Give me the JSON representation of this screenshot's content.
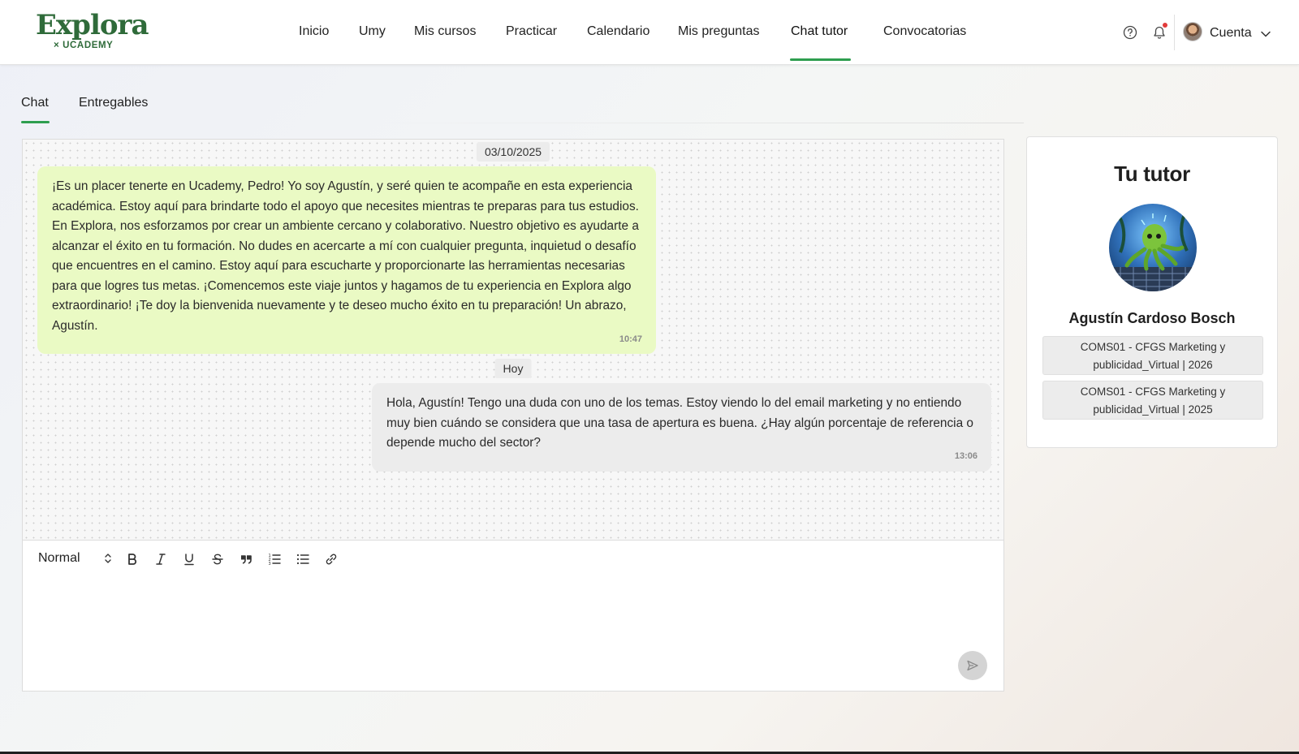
{
  "brand": {
    "name": "Explora",
    "sub": "× UCADEMY",
    "color": "#2f6b3a"
  },
  "nav": {
    "items": [
      {
        "label": "Inicio"
      },
      {
        "label": "Umy"
      },
      {
        "label": "Mis cursos"
      },
      {
        "label": "Practicar"
      },
      {
        "label": "Calendario"
      },
      {
        "label": "Mis preguntas"
      },
      {
        "label": "Chat tutor",
        "active": true
      },
      {
        "label": "Convocatorias"
      }
    ],
    "accent": "#2e9e4f"
  },
  "header": {
    "help_icon": "help-circle-icon",
    "bell_icon": "bell-icon",
    "account_label": "Cuenta"
  },
  "tabs": [
    {
      "label": "Chat",
      "active": true
    },
    {
      "label": "Entregables"
    }
  ],
  "chat": {
    "date_1": "03/10/2025",
    "message_in": {
      "text": "¡Es un placer tenerte en Ucademy, Pedro! Yo soy Agustín, y seré quien te acompañe en esta experiencia académica. Estoy aquí para brindarte todo el apoyo que necesites mientras te preparas para tus estudios. En Explora, nos esforzamos por crear un ambiente cercano y colaborativo. Nuestro objetivo es ayudarte a alcanzar el éxito en tu formación. No dudes en acercarte a mí con cualquier pregunta, inquietud o desafío que encuentres en el camino. Estoy aquí para escucharte y proporcionarte las herramientas necesarias para que logres tus metas. ¡Comencemos este viaje juntos y hagamos de tu experiencia en Explora algo extraordinario! ¡Te doy la bienvenida nuevamente y te deseo mucho éxito en tu preparación! Un abrazo, Agustín.",
      "time": "10:47",
      "bg": "#eafac4"
    },
    "date_2": "Hoy",
    "message_out": {
      "text": "Hola, Agustín! Tengo una duda con uno de los temas. Estoy viendo lo del email marketing y no entiendo muy bien cuándo se considera que una tasa de apertura es buena. ¿Hay algún porcentaje de referencia o depende mucho del sector?",
      "time": "13:06",
      "bg": "#ececec"
    }
  },
  "editor": {
    "format_value": "Normal",
    "toolbar": [
      "bold-icon",
      "italic-icon",
      "underline-icon",
      "strikethrough-icon",
      "quote-icon",
      "ordered-list-icon",
      "bullet-list-icon",
      "link-icon"
    ],
    "send_icon": "send-icon"
  },
  "tutor": {
    "title": "Tu tutor",
    "name": "Agustín Cardoso Bosch",
    "courses": [
      "COMS01 - CFGS Marketing y publicidad_Virtual | 2026",
      "COMS01 - CFGS Marketing y publicidad_Virtual | 2025"
    ]
  }
}
